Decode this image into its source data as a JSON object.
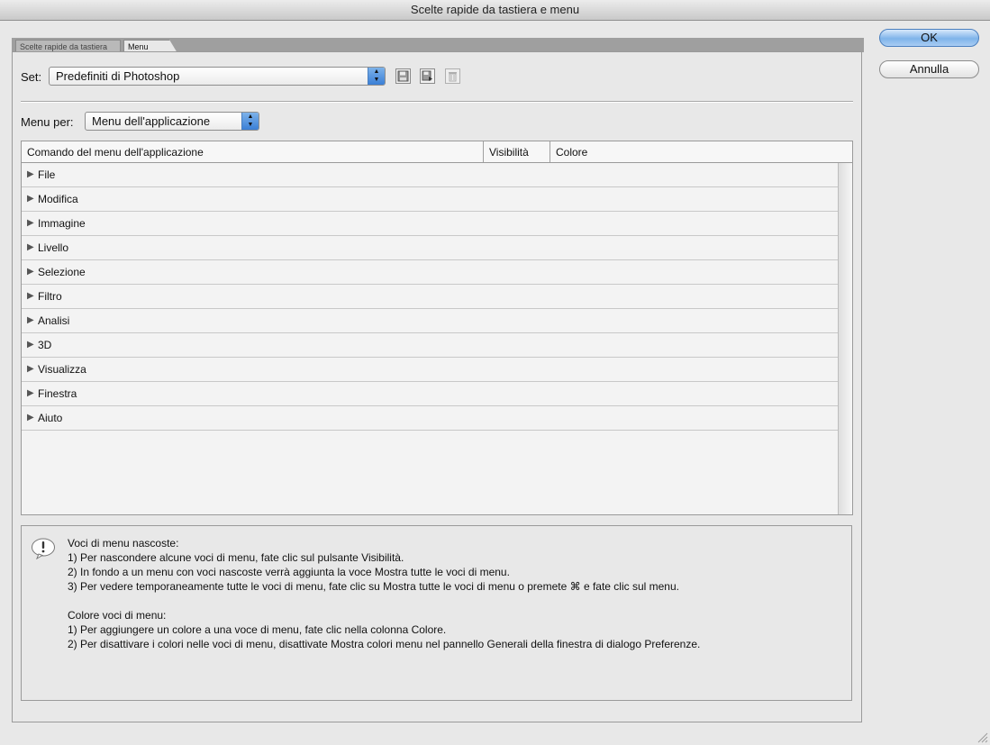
{
  "window": {
    "title": "Scelte rapide da tastiera e menu"
  },
  "tabs": [
    {
      "label": "Scelte rapide da tastiera"
    },
    {
      "label": "Menu"
    }
  ],
  "buttons": {
    "ok": "OK",
    "cancel": "Annulla"
  },
  "set": {
    "label": "Set:",
    "value": "Predefiniti di Photoshop"
  },
  "menu_for": {
    "label": "Menu per:",
    "value": "Menu dell'applicazione"
  },
  "table": {
    "columns": [
      "Comando del menu dell'applicazione",
      "Visibilità",
      "Colore"
    ],
    "rows": [
      "File",
      "Modifica",
      "Immagine",
      "Livello",
      "Selezione",
      "Filtro",
      "Analisi",
      "3D",
      "Visualizza",
      "Finestra",
      "Aiuto"
    ]
  },
  "info": {
    "lines": [
      "Voci di menu nascoste:",
      "1) Per nascondere alcune voci di menu, fate clic sul pulsante Visibilità.",
      "2) In fondo a un menu con voci nascoste verrà aggiunta la voce Mostra tutte le voci di menu.",
      "3) Per vedere temporaneamente tutte le voci di menu, fate clic su Mostra tutte le voci di menu o premete ⌘ e fate clic sul menu.",
      "",
      "Colore voci di menu:",
      "1) Per aggiungere un colore a una voce di menu, fate clic nella colonna Colore.",
      "2) Per disattivare i colori nelle voci di menu, disattivate Mostra colori menu nel pannello Generali della finestra di dialogo Preferenze."
    ]
  },
  "icons": {
    "save": "floppy-disk-icon",
    "save_as": "save-as-icon",
    "delete": "trash-icon",
    "info": "exclamation-speech-bubble-icon"
  }
}
